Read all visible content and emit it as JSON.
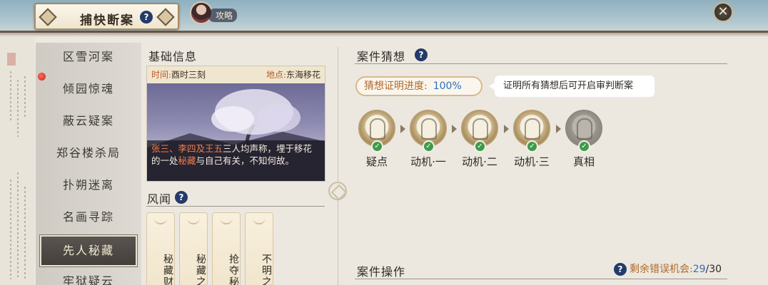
{
  "header": {
    "title": "捕快断案",
    "help_icon": "question-icon",
    "guide_label": "攻略",
    "close_icon": "close-icon"
  },
  "sidebar": {
    "items": [
      {
        "label": "区雪河案",
        "active": false
      },
      {
        "label": "倾园惊魂",
        "active": false
      },
      {
        "label": "蔽云疑案",
        "active": false
      },
      {
        "label": "郑谷楼杀局",
        "active": false
      },
      {
        "label": "扑朔迷离",
        "active": false
      },
      {
        "label": "名画寻踪",
        "active": false
      },
      {
        "label": "先人秘藏",
        "active": true
      },
      {
        "label": "牢狱疑云",
        "active": false
      }
    ]
  },
  "basic_info": {
    "title": "基础信息",
    "time_key": "时间:",
    "time_val": "酉时三刻",
    "place_key": "地点:",
    "place_val": "东海移花",
    "desc_names": "张三、李四及王五",
    "desc_part1": "三人均声称，埋于移花的一处",
    "desc_hl2": "秘藏",
    "desc_part2": "与自己有关，不知何故。"
  },
  "rumors": {
    "title": "风闻",
    "cards": [
      "秘藏财",
      "秘藏之",
      "抢夺秘",
      "不明之"
    ]
  },
  "case_guess": {
    "title": "案件猜想",
    "progress_label": "猜想证明进度:",
    "progress_value": "100%",
    "tip": "证明所有猜想后可开启审判断案",
    "steps": [
      {
        "label": "疑点",
        "done": true
      },
      {
        "label": "动机·一",
        "done": true
      },
      {
        "label": "动机·二",
        "done": true
      },
      {
        "label": "动机·三",
        "done": true
      },
      {
        "label": "真相",
        "done": true
      }
    ],
    "check_glyph": "✓"
  },
  "case_ops": {
    "title": "案件操作",
    "errors_label": "剩余错误机会:",
    "errors_current": "29",
    "errors_sep": "/",
    "errors_total": "30"
  }
}
